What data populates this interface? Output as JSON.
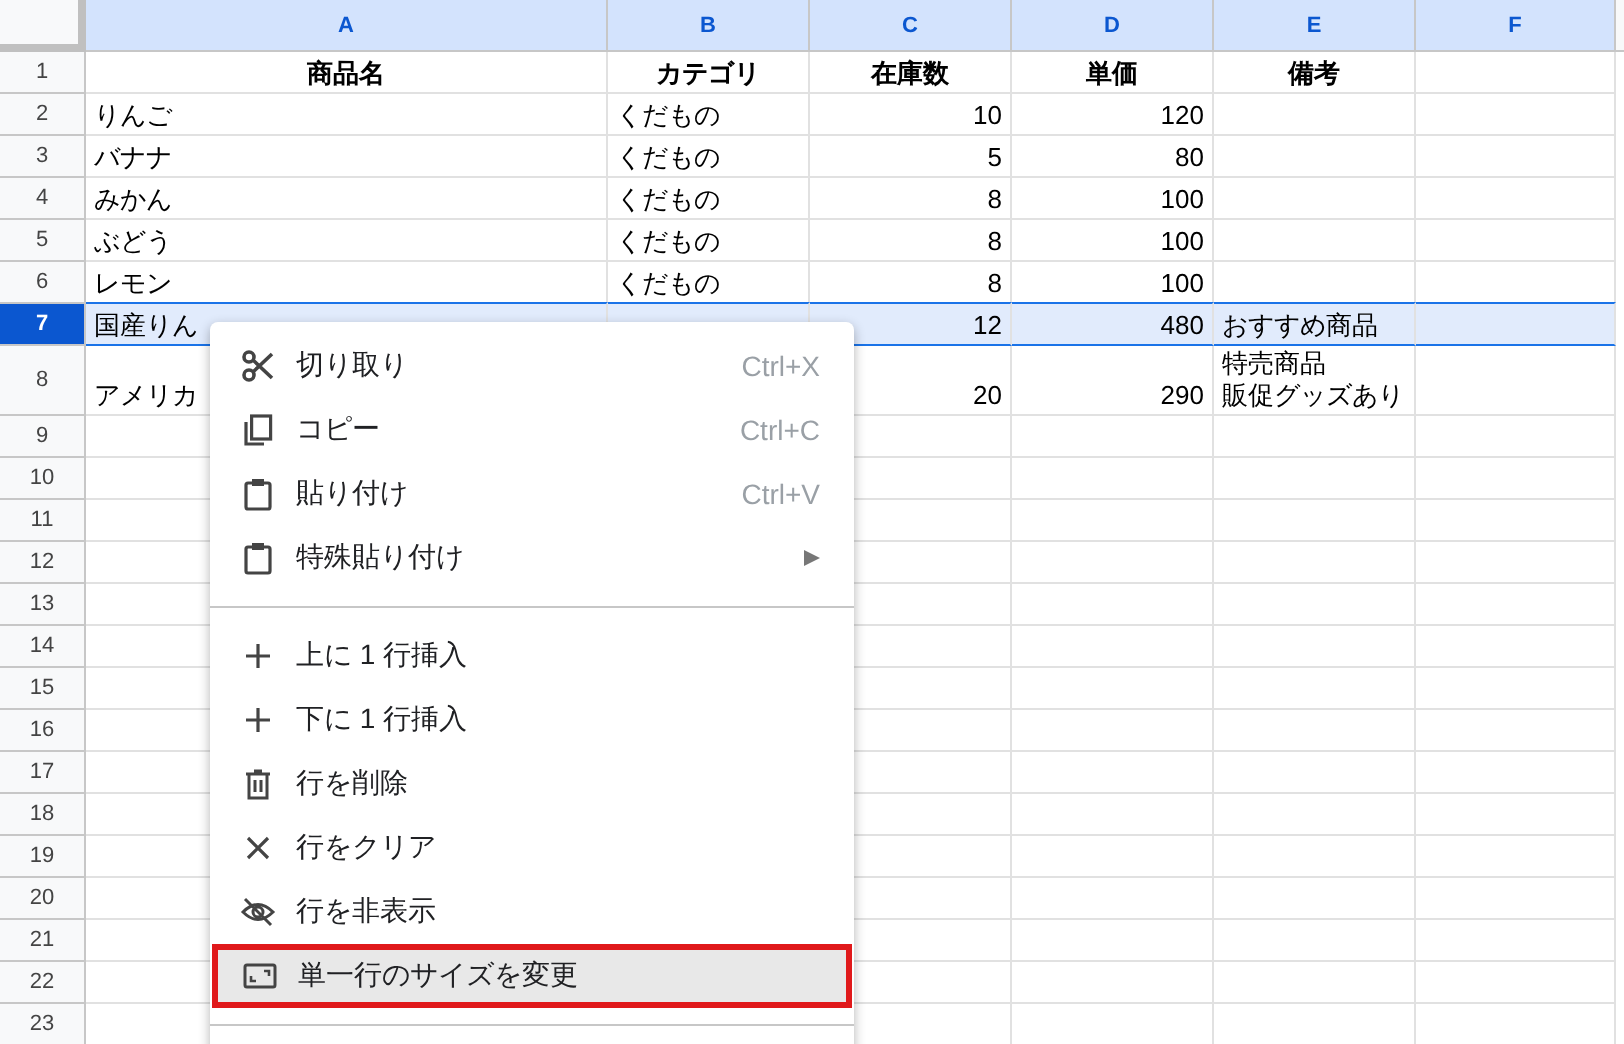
{
  "columns": [
    {
      "label": "A",
      "selected": true
    },
    {
      "label": "B",
      "selected": true
    },
    {
      "label": "C",
      "selected": true
    },
    {
      "label": "D",
      "selected": true
    },
    {
      "label": "E",
      "selected": true
    },
    {
      "label": "F",
      "selected": true
    }
  ],
  "header_row": {
    "number": "1",
    "selected": false,
    "cells": [
      "商品名",
      "カテゴリ",
      "在庫数",
      "単価",
      "備考",
      ""
    ]
  },
  "rows": [
    {
      "number": "2",
      "selected": false,
      "cells": [
        "りんご",
        "くだもの",
        "10",
        "120",
        "",
        ""
      ]
    },
    {
      "number": "3",
      "selected": false,
      "cells": [
        "バナナ",
        "くだもの",
        "5",
        "80",
        "",
        ""
      ]
    },
    {
      "number": "4",
      "selected": false,
      "cells": [
        "みかん",
        "くだもの",
        "8",
        "100",
        "",
        ""
      ]
    },
    {
      "number": "5",
      "selected": false,
      "cells": [
        "ぶどう",
        "くだもの",
        "8",
        "100",
        "",
        ""
      ]
    },
    {
      "number": "6",
      "selected": false,
      "cells": [
        "レモン",
        "くだもの",
        "8",
        "100",
        "",
        ""
      ]
    },
    {
      "number": "7",
      "selected": true,
      "cells": [
        "国産りん",
        "",
        "12",
        "480",
        "おすすめ商品",
        ""
      ]
    },
    {
      "number": "8",
      "selected": false,
      "cells": [
        "アメリカ",
        "",
        "20",
        "290",
        [
          "特売商品",
          "販促グッズあり"
        ],
        ""
      ]
    },
    {
      "number": "9",
      "selected": false,
      "cells": []
    },
    {
      "number": "10",
      "selected": false,
      "cells": []
    },
    {
      "number": "11",
      "selected": false,
      "cells": []
    },
    {
      "number": "12",
      "selected": false,
      "cells": []
    },
    {
      "number": "13",
      "selected": false,
      "cells": []
    },
    {
      "number": "14",
      "selected": false,
      "cells": []
    },
    {
      "number": "15",
      "selected": false,
      "cells": []
    },
    {
      "number": "16",
      "selected": false,
      "cells": []
    },
    {
      "number": "17",
      "selected": false,
      "cells": []
    },
    {
      "number": "18",
      "selected": false,
      "cells": []
    },
    {
      "number": "19",
      "selected": false,
      "cells": []
    },
    {
      "number": "20",
      "selected": false,
      "cells": []
    },
    {
      "number": "21",
      "selected": false,
      "cells": []
    },
    {
      "number": "22",
      "selected": false,
      "cells": []
    },
    {
      "number": "23",
      "selected": false,
      "cells": []
    }
  ],
  "context_menu": {
    "sections": [
      [
        {
          "kind": "cut",
          "label": "切り取り",
          "shortcut": "Ctrl+X",
          "selected": false
        },
        {
          "kind": "copy",
          "label": "コピー",
          "shortcut": "Ctrl+C",
          "selected": false
        },
        {
          "kind": "paste",
          "label": "貼り付け",
          "shortcut": "Ctrl+V",
          "selected": false
        },
        {
          "kind": "paste",
          "label": "特殊貼り付け",
          "submenu": true,
          "selected": false
        }
      ],
      [
        {
          "kind": "add",
          "label": "上に 1 行挿入",
          "selected": false
        },
        {
          "kind": "add",
          "label": "下に 1 行挿入",
          "selected": false
        },
        {
          "kind": "delete",
          "label": "行を削除",
          "selected": false
        },
        {
          "kind": "clear",
          "label": "行をクリア",
          "selected": false
        },
        {
          "kind": "hide",
          "label": "行を非表示",
          "selected": false
        },
        {
          "kind": "resize",
          "label": "単一行のサイズを変更",
          "selected": true
        }
      ]
    ]
  }
}
